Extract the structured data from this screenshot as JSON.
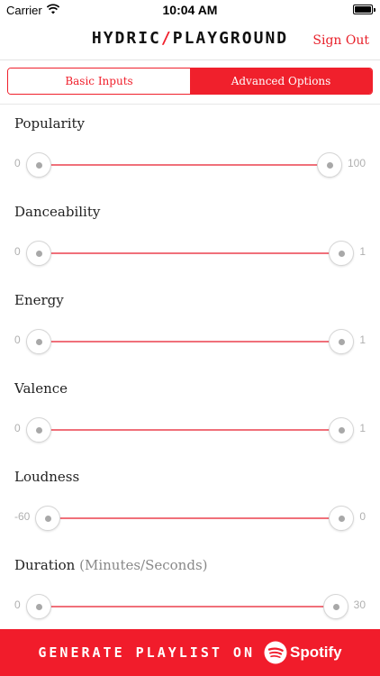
{
  "status_bar": {
    "carrier": "Carrier",
    "time": "10:04 AM"
  },
  "header": {
    "logo_left": "HYDRIC",
    "logo_slash": "/",
    "logo_right": "PLAYGROUND",
    "sign_out": "Sign Out"
  },
  "tabs": [
    {
      "label": "Basic Inputs",
      "selected": false
    },
    {
      "label": "Advanced Options",
      "selected": true
    }
  ],
  "filters": [
    {
      "label": "Popularity",
      "sublabel": "",
      "min_label": "0",
      "max_label": "100",
      "min": 0,
      "max": 100,
      "low": 0,
      "high": 100
    },
    {
      "label": "Danceability",
      "sublabel": "",
      "min_label": "0",
      "max_label": "1",
      "min": 0,
      "max": 1,
      "low": 0,
      "high": 1
    },
    {
      "label": "Energy",
      "sublabel": "",
      "min_label": "0",
      "max_label": "1",
      "min": 0,
      "max": 1,
      "low": 0,
      "high": 1
    },
    {
      "label": "Valence",
      "sublabel": "",
      "min_label": "0",
      "max_label": "1",
      "min": 0,
      "max": 1,
      "low": 0,
      "high": 1
    },
    {
      "label": "Loudness",
      "sublabel": "",
      "min_label": "-60",
      "max_label": "0",
      "min": -60,
      "max": 0,
      "low": -60,
      "high": 0
    },
    {
      "label": "Duration",
      "sublabel": "(Minutes/Seconds)",
      "min_label": "0",
      "max_label": "30",
      "min": 0,
      "max": 30,
      "low": 0,
      "high": 30
    }
  ],
  "footer": {
    "generate_label": "GENERATE PLAYLIST ON",
    "spotify_label": "Spotify",
    "background_color": "#f11c2b"
  },
  "icons": {
    "wifi": "wifi-icon",
    "battery": "battery-icon",
    "spotify": "spotify-logo-icon"
  },
  "colors": {
    "accent": "#f0202c",
    "track": "#f0707a"
  }
}
